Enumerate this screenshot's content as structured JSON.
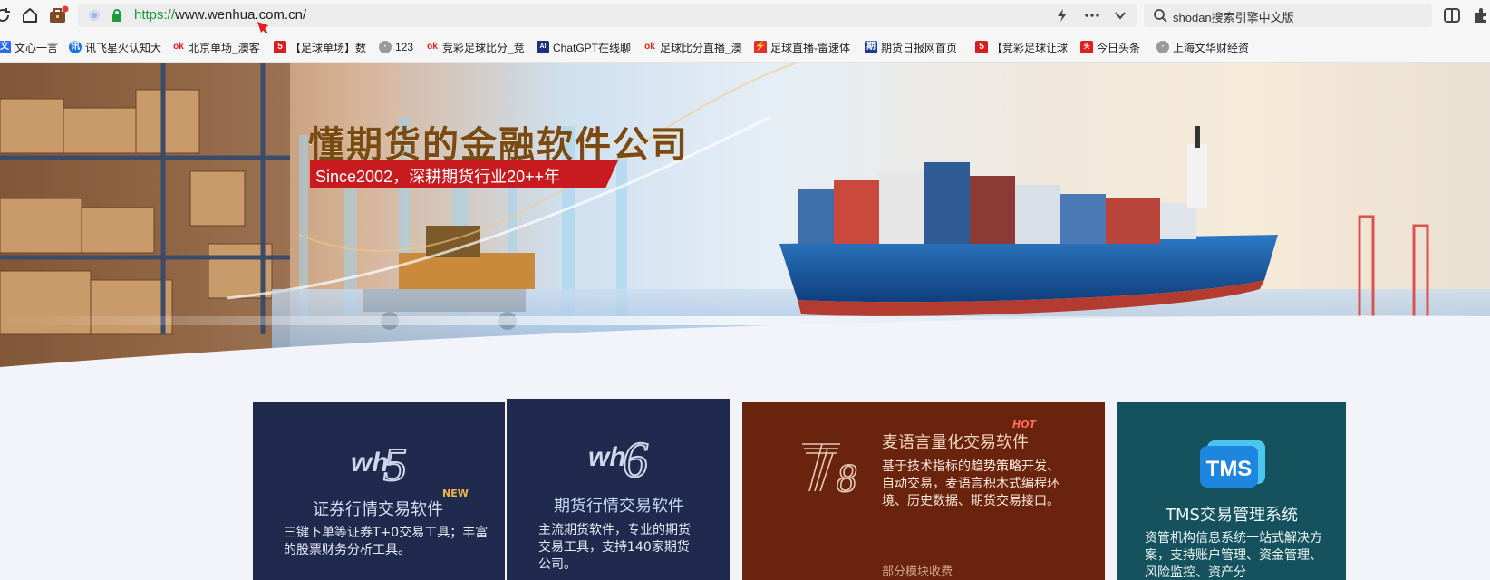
{
  "browser": {
    "url_scheme": "https://",
    "url_host": "www.wenhua.com.cn/",
    "search_text": "shodan搜索引擎中文版"
  },
  "bookmarks": [
    {
      "label": "文心一言",
      "icon": "wenxin-icon",
      "color": "#2a6bf2"
    },
    {
      "label": "讯飞星火认知大",
      "icon": "xunfei-icon",
      "color": "#1a73e8"
    },
    {
      "label": "北京单场_澳客",
      "icon": "ok-icon",
      "color": "#e0201c"
    },
    {
      "label": "【足球单场】数",
      "icon": "five-icon",
      "color": "#d81e1e"
    },
    {
      "label": "123",
      "icon": "globe-icon",
      "color": "#888888"
    },
    {
      "label": "竞彩足球比分_竞",
      "icon": "ok-icon",
      "color": "#e0201c"
    },
    {
      "label": "ChatGPT在线聊",
      "icon": "chatgpt-icon",
      "color": "#1f2e80"
    },
    {
      "label": "足球比分直播_澳",
      "icon": "ok-icon",
      "color": "#e0201c"
    },
    {
      "label": "足球直播-雷速体",
      "icon": "leisu-icon",
      "color": "#e03030"
    },
    {
      "label": "期货日报网首页",
      "icon": "qhrb-icon",
      "color": "#1a3a9a"
    },
    {
      "label": "【竞彩足球让球",
      "icon": "five-icon",
      "color": "#d81e1e"
    },
    {
      "label": "今日头条",
      "icon": "toutiao-icon",
      "color": "#e02020"
    },
    {
      "label": "上海文华财经资",
      "icon": "globe-icon",
      "color": "#888888"
    }
  ],
  "banner": {
    "headline": "懂期货的金融软件公司",
    "tagline": "Since2002，深耕期货行业20++年"
  },
  "cards": [
    {
      "logo": "wh5",
      "title": "证券行情交易软件",
      "badge": "NEW",
      "desc": "三键下单等证券T+0交易工具；丰富的股票财务分析工具。",
      "bg": "#1f2a4e"
    },
    {
      "logo": "wh6",
      "title": "期货行情交易软件",
      "desc": "主流期货软件，专业的期货交易工具，支持140家期货公司。",
      "bg": "#1f2a4e"
    },
    {
      "logo": "T8",
      "title": "麦语言量化交易软件",
      "badge": "HOT",
      "desc": "基于技术指标的趋势策略开发、自动交易，麦语言积木式编程环境、历史数据、期货交易接口。",
      "fee": "部分模块收费",
      "bg": "#6a230c"
    },
    {
      "logo": "TMS",
      "title": "TMS交易管理系统",
      "desc": "资管机构信息系统一站式解决方案，支持账户管理、资金管理、风险监控、资产分",
      "bg": "#16525d"
    }
  ]
}
